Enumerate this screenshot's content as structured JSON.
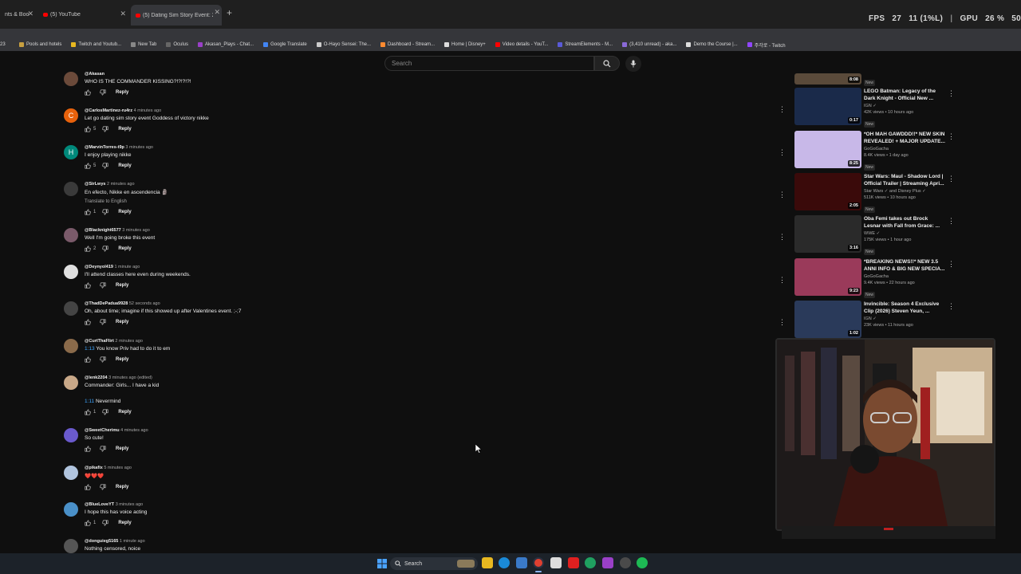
{
  "browser": {
    "tabs": [
      {
        "title": "nts & Boo"
      },
      {
        "title": "(5) YouTube"
      },
      {
        "title": "(5) Dating Sim Story Event: 2X"
      }
    ],
    "new_tab_symbol": "+"
  },
  "overlay": {
    "fps_label": "FPS",
    "fps_value": "27",
    "frame": "11 (1%L)",
    "gpu_label": "GPU",
    "gpu_value": "26 %",
    "tail": "50"
  },
  "bookmarks": [
    "Pools and hotels",
    "Twitch and Youtub...",
    "New Tab",
    "Oculus",
    "Akasan_Plays - Chat...",
    "Google Translate",
    "O-Hayo Sensei: The...",
    "Dashboard - Stream...",
    "Home | Disney+",
    "Video details - YouT...",
    "StreamElements - M...",
    "(3,410 unread) - aka...",
    "Demo the Course |...",
    "주각로 - Twitch"
  ],
  "search": {
    "placeholder": "Search"
  },
  "comments": [
    {
      "handle": "@Akasan",
      "time": "",
      "text": "WHO IS THE COMMANDER KISSING?!?!?!?!",
      "likes": "",
      "avatar_letter": "",
      "avatar_color": "#6b4a3a"
    },
    {
      "handle": "@CarlosMartinez-ru4rz",
      "time": "4 minutes ago",
      "text": "Let go dating sim story event Goddess of victory nikke",
      "likes": "5",
      "avatar_letter": "C",
      "avatar_color": "#e8620c"
    },
    {
      "handle": "@MarvinTorres-t9p",
      "time": "3 minutes ago",
      "text": "I enjoy playing nikke",
      "likes": "5",
      "avatar_letter": "H",
      "avatar_color": "#00897b"
    },
    {
      "handle": "@SirLwys",
      "time": "2 minutes ago",
      "text": "En efecto, Nikke en ascendencia 🗿",
      "translate": "Translate to English",
      "likes": "1",
      "avatar_letter": "",
      "avatar_color": "#3a3a3a"
    },
    {
      "handle": "@Blacknight6577",
      "time": "3 minutes ago",
      "text": "Well I'm going broke this event",
      "likes": "2",
      "avatar_letter": "",
      "avatar_color": "#7a5a6a"
    },
    {
      "handle": "@Deynyol419",
      "time": "1 minute ago",
      "text": "I'll attend classes here even during weekends.",
      "likes": "",
      "avatar_letter": "",
      "avatar_color": "#e0e0e0"
    },
    {
      "handle": "@ThadDePadua9928",
      "time": "52 seconds ago",
      "text": "Oh, about time; imagine if this showed up after Valentines event. ;-;7",
      "likes": "",
      "avatar_letter": "",
      "avatar_color": "#444444"
    },
    {
      "handle": "@CurtThaFlirt",
      "time": "2 minutes ago",
      "ts": "1:13",
      "text": " You know Priv had to do it to em",
      "likes": "",
      "avatar_letter": "",
      "avatar_color": "#8a6a4a"
    },
    {
      "handle": "@lenk2204",
      "time": "3 minutes ago (edited)",
      "text": "Commander: Girls... I have a kid",
      "ts2": "1:11",
      "text2": " Nevermind",
      "likes": "1",
      "avatar_letter": "",
      "avatar_color": "#c8a888"
    },
    {
      "handle": "@SweetCherimu",
      "time": "4 minutes ago",
      "text": "So cute!",
      "likes": "",
      "avatar_letter": "",
      "avatar_color": "#6a5acd"
    },
    {
      "handle": "@pikafix",
      "time": "5 minutes ago",
      "text": "❤️❤️❤️",
      "likes": "",
      "avatar_letter": "",
      "avatar_color": "#b0c4de"
    },
    {
      "handle": "@BlueLoveYT",
      "time": "3 minutes ago",
      "text": "I hope this has voice acting",
      "likes": "1",
      "avatar_letter": "",
      "avatar_color": "#4a90c8"
    },
    {
      "handle": "@donguieg5165",
      "time": "1 minute ago",
      "text": "Nothing censored, noice",
      "likes": "",
      "avatar_letter": "",
      "avatar_color": "#555555"
    }
  ],
  "actions": {
    "reply": "Reply"
  },
  "videos": [
    {
      "title1": "",
      "title2": "",
      "channel": "",
      "views": "",
      "duration": "8:08",
      "badge": "New",
      "thumb_color": "#5a4a3a"
    },
    {
      "title1": "LEGO Batman: Legacy of the",
      "title2": "Dark Knight - Official New ...",
      "channel": "IGN ✓",
      "views": "42K views • 10 hours ago",
      "duration": "0:17",
      "badge": "New",
      "thumb_color": "#1a2a4a"
    },
    {
      "title1": "*OH MAH GAWDDD!!* NEW SKIN",
      "title2": "REVEALED! + MAJOR UPDATE...",
      "channel": "GoGoGacha",
      "views": "8.4K views • 1 day ago",
      "duration": "8:25",
      "badge": "New",
      "thumb_color": "#c8b8e8"
    },
    {
      "title1": "Star Wars: Maul - Shadow Lord |",
      "title2": "Official Trailer | Streaming Apri...",
      "channel": "Star Wars ✓ and Disney Plus ✓",
      "views": "511K views • 10 hours ago",
      "duration": "2:05",
      "badge": "New",
      "thumb_color": "#3a0a0a"
    },
    {
      "title1": "Oba Femi takes out Brock",
      "title2": "Lesnar with Fall from Grace: ...",
      "channel": "WWE ✓",
      "views": "175K views • 1 hour ago",
      "duration": "3:16",
      "badge": "New",
      "thumb_color": "#2a2a2a"
    },
    {
      "title1": "*BREAKING NEWS!!* NEW 3.5",
      "title2": "ANNI INFO & BIG NEW SPECIA...",
      "channel": "GoGoGacha",
      "views": "9.4K views • 22 hours ago",
      "duration": "9:23",
      "badge": "New",
      "thumb_color": "#9a3a5a"
    },
    {
      "title1": "Invincible: Season 4 Exclusive",
      "title2": "Clip (2026) Steven Yeun, ...",
      "channel": "IGN ✓",
      "views": "23K views • 11 hours ago",
      "duration": "1:02",
      "badge": "",
      "thumb_color": "#2a3a5a"
    }
  ],
  "taskbar": {
    "search_label": "Search"
  },
  "colors": {
    "yt_red": "#ff0000",
    "link_blue": "#3ea6ff",
    "bg": "#0f0f0f"
  }
}
